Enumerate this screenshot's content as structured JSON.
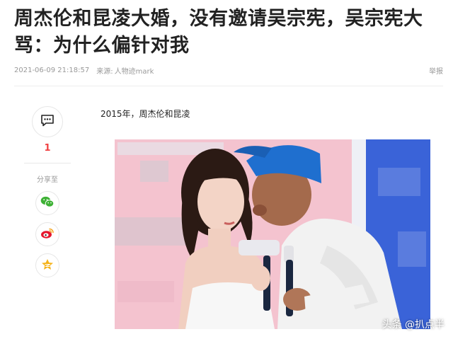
{
  "article": {
    "title": "周杰伦和昆凌大婚，没有邀请吴宗宪，吴宗宪大骂：为什么偏针对我",
    "timestamp": "2021-06-09 21:18:57",
    "source_label": "来源:",
    "source_name": "人物迹mark",
    "report_label": "举报"
  },
  "sidebar": {
    "comment_icon": "comment-bubble-icon",
    "comment_count": "1",
    "share_label": "分享至",
    "share_targets": [
      {
        "icon": "wechat-icon",
        "color": "#3eb135"
      },
      {
        "icon": "weibo-icon",
        "color": "#e6162d"
      },
      {
        "icon": "qzone-icon",
        "color": "#f5b31a"
      }
    ]
  },
  "content": {
    "caption": "2015年，周杰伦和昆凌",
    "watermark": "头条 @扒点半"
  },
  "colors": {
    "accent": "#f04142",
    "meta_text": "#999999",
    "photo_bg_pink": "#f4c3cf",
    "photo_bg_blue": "#3a63d8"
  }
}
